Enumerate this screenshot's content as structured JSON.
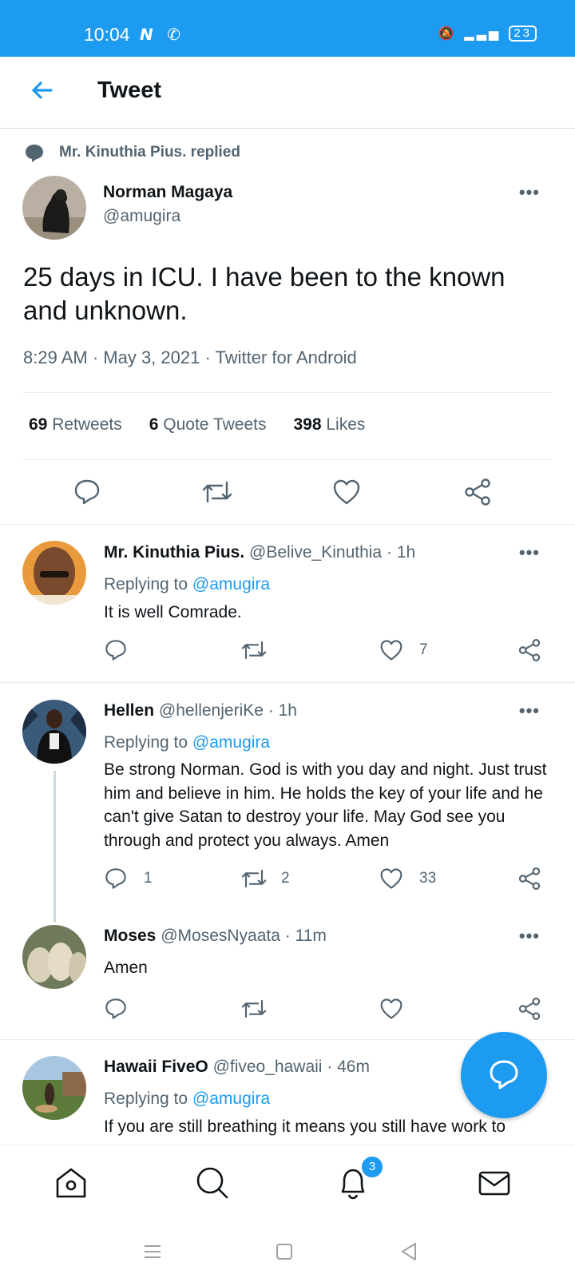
{
  "status_bar": {
    "time": "10:04",
    "battery": "23"
  },
  "header": {
    "title": "Tweet"
  },
  "social_context": {
    "text": "Mr. Kinuthia Pius. replied"
  },
  "tweet": {
    "author_name": "Norman Magaya",
    "author_handle": "@amugira",
    "text": "25 days in ICU. I have been to the known and unknown.",
    "meta": "8:29 AM · May 3, 2021 · Twitter for Android",
    "retweets_count": "69",
    "retweets_label": "Retweets",
    "quotes_count": "6",
    "quotes_label": "Quote Tweets",
    "likes_count": "398",
    "likes_label": "Likes"
  },
  "replies": [
    {
      "name": "Mr. Kinuthia Pius.",
      "handle": "@Belive_Kinuthia · 1h",
      "replying_prefix": "Replying to",
      "replying_to": "@amugira",
      "text": "It is well Comrade.",
      "reply_count": "",
      "retweet_count": "",
      "like_count": "7"
    },
    {
      "name": "Hellen",
      "handle": "@hellenjeriKe · 1h",
      "replying_prefix": "Replying to",
      "replying_to": "@amugira",
      "text": "Be strong Norman. God is with you day and night. Just trust him and believe in him. He holds the key of your life and he can't give Satan to destroy your life. May God see you through and protect you always. Amen",
      "reply_count": "1",
      "retweet_count": "2",
      "like_count": "33"
    },
    {
      "name": "Moses",
      "handle": "@MosesNyaata · 11m",
      "text": "Amen",
      "reply_count": "",
      "retweet_count": "",
      "like_count": ""
    },
    {
      "name": "Hawaii FiveO",
      "handle": "@fiveo_hawaii · 46m",
      "replying_prefix": "Replying to",
      "replying_to": "@amugira",
      "text": "If you are still breathing it means you still have work to"
    }
  ],
  "notifications_badge": "3",
  "colors": {
    "accent": "#1d9bf0",
    "secondary_text": "#536471",
    "border": "#e6ecf0"
  }
}
